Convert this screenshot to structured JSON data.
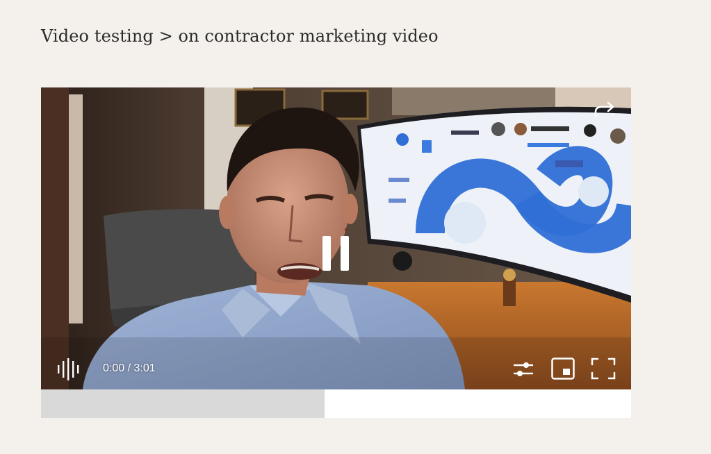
{
  "breadcrumb": {
    "text": "Video testing > on contractor marketing video"
  },
  "player": {
    "current_time": "0:00",
    "duration": "3:01",
    "progress_fraction": 0.48,
    "icons": {
      "share": "share-arrow-icon",
      "pause": "pause-icon",
      "audio": "audio-waveform-icon",
      "settings": "settings-sliders-icon",
      "pip": "picture-in-picture-icon",
      "fullscreen": "fullscreen-icon"
    },
    "colors": {
      "page_background": "#f4f1ec",
      "progress_played": "#d9d9d9",
      "progress_remaining": "#ffffff"
    }
  }
}
